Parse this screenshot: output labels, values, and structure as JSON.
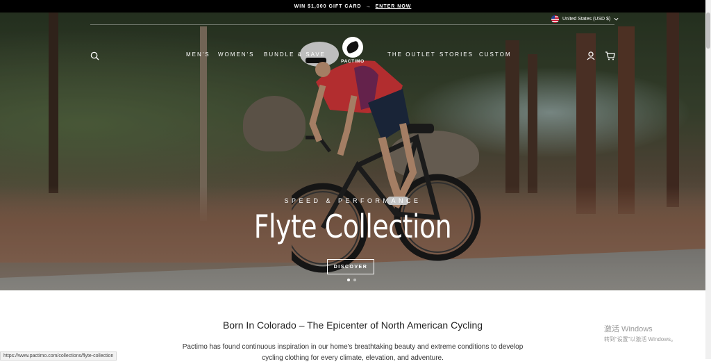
{
  "announcement": {
    "text": "WIN $1,000 GIFT CARD",
    "arrow": "→",
    "link": "ENTER NOW"
  },
  "header": {
    "currency": "United States (USD $)",
    "logo_text": "PACTIMO",
    "nav_left": [
      "MEN'S",
      "WOMEN'S",
      "BUNDLE & SAVE"
    ],
    "nav_right": [
      "THE OUTLET",
      "STORIES",
      "CUSTOM"
    ]
  },
  "hero": {
    "subtitle": "SPEED & PERFORMANCE",
    "title": "Flyte Collection",
    "cta": "DISCOVER",
    "slides": 2,
    "active_slide": 1
  },
  "intro": {
    "title": "Born In Colorado – The Epicenter of North American Cycling",
    "body": "Pactimo has found continuous inspiration in our home's breathtaking beauty and extreme conditions to develop cycling clothing for every climate, elevation, and adventure."
  },
  "status_bar": {
    "url": "https://www.pactimo.com/collections/flyte-collection"
  },
  "watermark": {
    "line1": "激活 Windows",
    "line2": "转到“设置”以激活 Windows。"
  },
  "colors": {
    "announcement_bg": "#000000",
    "jersey_red": "#d9383a",
    "jersey_purple": "#7a2a5c"
  }
}
